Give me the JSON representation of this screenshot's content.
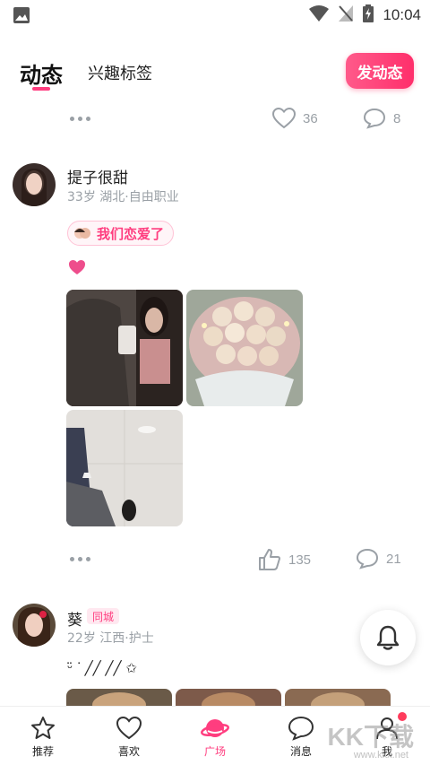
{
  "status_bar": {
    "time": "10:04"
  },
  "header": {
    "tab_active": "动态",
    "tab_inactive": "兴趣标签",
    "post_button": "发动态"
  },
  "prev_post_actions": {
    "likes": "36",
    "comments": "8"
  },
  "post1": {
    "username": "提子很甜",
    "meta": "33岁 湖北·自由职业",
    "relation_tag": "我们恋爱了",
    "emoji": "heart",
    "photo_count": 3,
    "actions": {
      "likes": "135",
      "comments": "21"
    }
  },
  "post2": {
    "username": "葵",
    "badge": "同城",
    "meta": "22岁 江西·护士",
    "text": "ᵕ̈ ᐝ ╱╱ ╱╱ ✩"
  },
  "bottom_nav": {
    "items": [
      {
        "label": "推荐",
        "icon": "star-icon"
      },
      {
        "label": "喜欢",
        "icon": "heart-icon"
      },
      {
        "label": "广场",
        "icon": "planet-icon"
      },
      {
        "label": "消息",
        "icon": "message-icon"
      },
      {
        "label": "我",
        "icon": "person-icon"
      }
    ],
    "active_index": 2
  },
  "watermark": {
    "logo": "KK下载",
    "url": "www.kkx.net"
  },
  "colors": {
    "accent": "#ff3d7f",
    "muted": "#9aa0a6"
  }
}
